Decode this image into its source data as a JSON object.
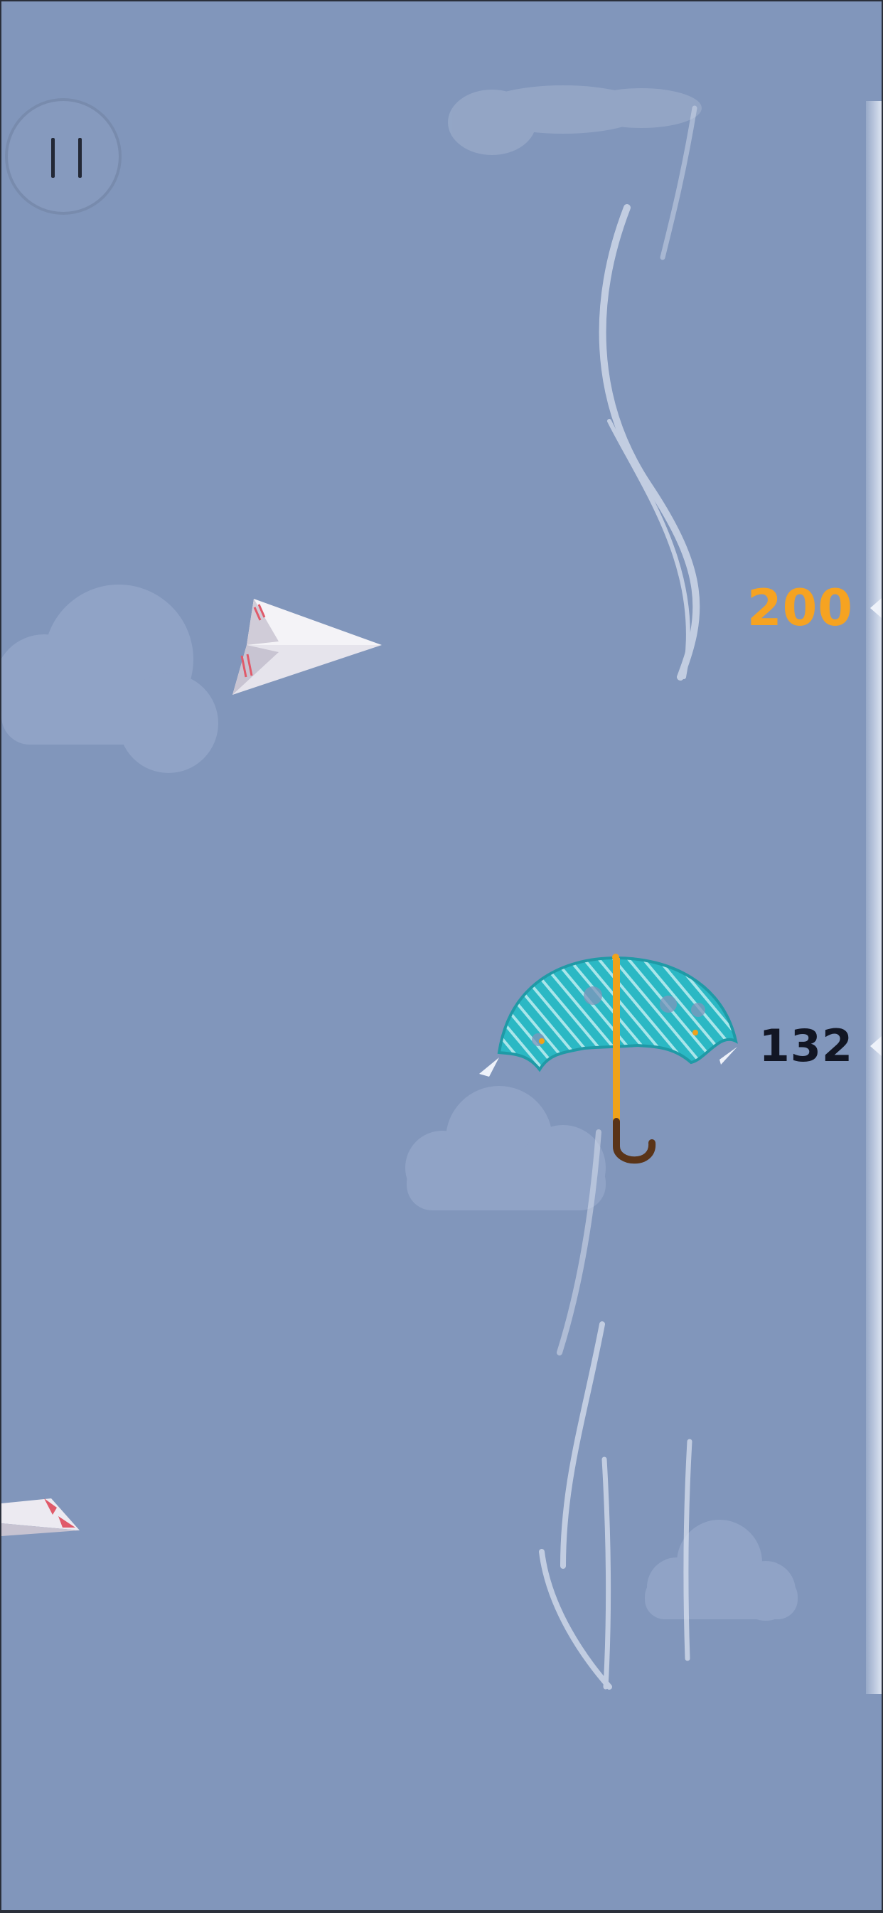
{
  "pause": {
    "icon": "pause-icon"
  },
  "altitude": {
    "best_marker": "200",
    "current_marker": "132",
    "best_color": "#f6a321",
    "current_color": "#121624"
  },
  "scene": {
    "sky_color": "#8196bb",
    "player": "umbrella",
    "umbrella_canopy_color": "#2bb8c4",
    "umbrella_handle_color": "#f0a21a",
    "obstacles": [
      "paper-plane",
      "paper-plane"
    ]
  }
}
